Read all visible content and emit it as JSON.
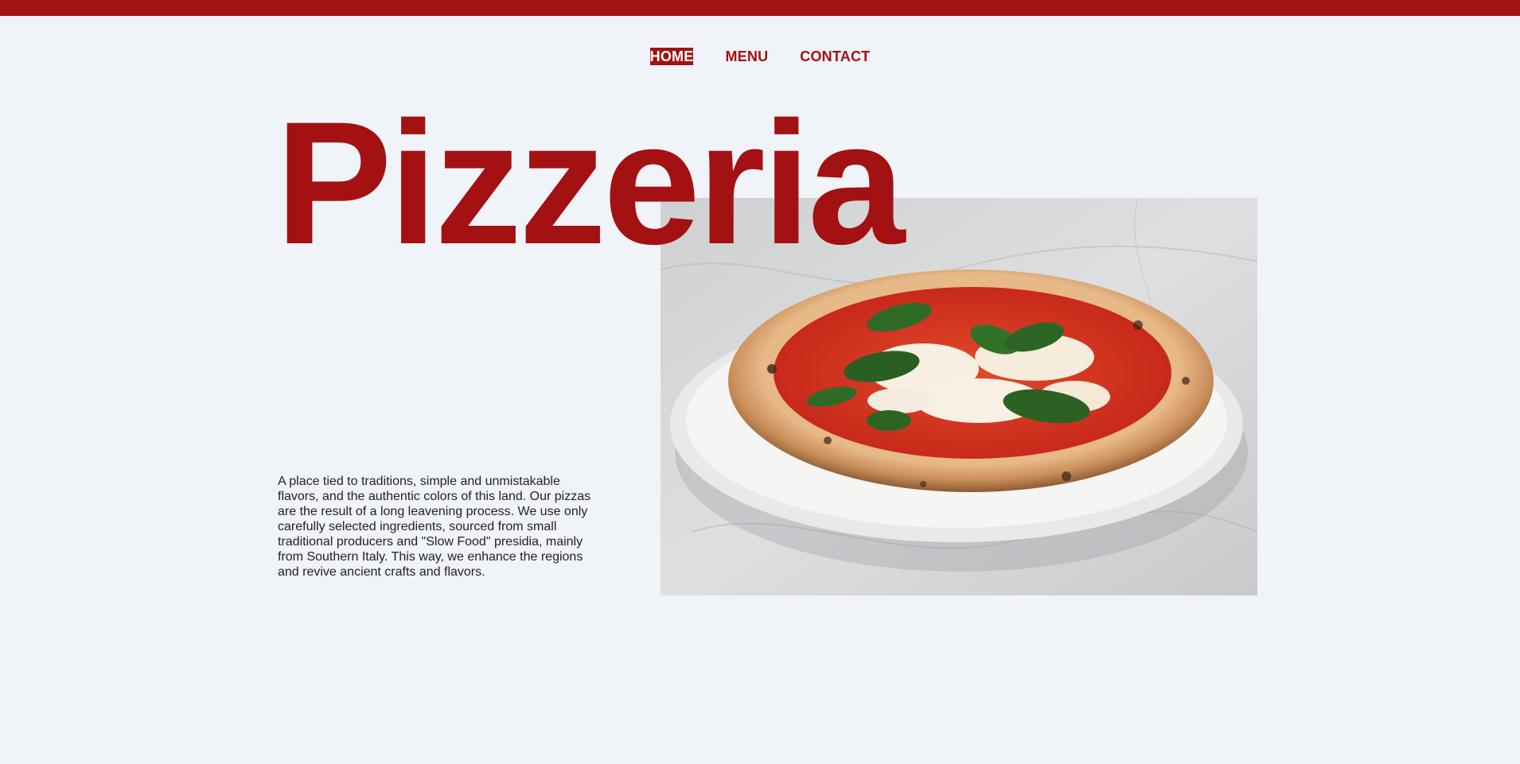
{
  "colors": {
    "brand": "#a31113",
    "background": "#f0f3f8",
    "text": "#222222"
  },
  "nav": {
    "items": [
      {
        "label": "HOME",
        "active": true
      },
      {
        "label": "MENU",
        "active": false
      },
      {
        "label": "CONTACT",
        "active": false
      }
    ]
  },
  "hero": {
    "title": "Pizzeria",
    "image_subject": "margherita-pizza-photo",
    "description": "A place tied to traditions, simple and unmistakable flavors, and the authentic colors of this land. Our pizzas are the result of a long leavening process. We use only carefully selected ingredients, sourced from small traditional producers and \"Slow Food\" presidia, mainly from Southern Italy. This way, we enhance the regions and revive ancient crafts and flavors."
  }
}
